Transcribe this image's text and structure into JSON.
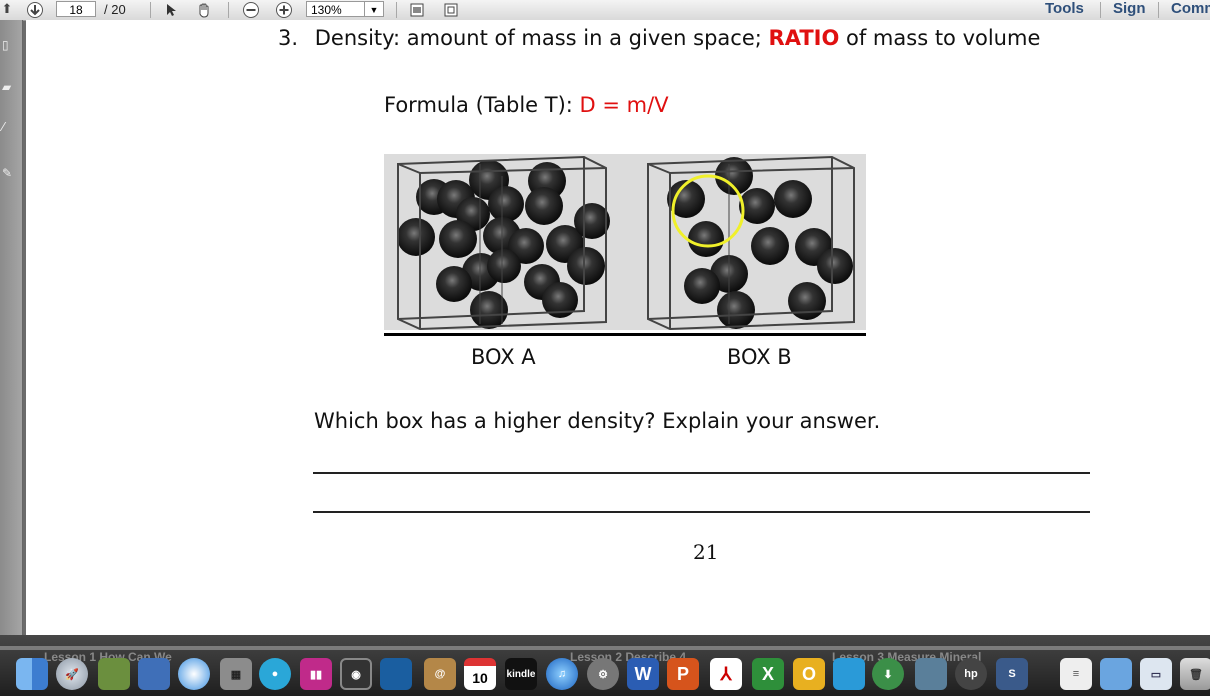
{
  "toolbar": {
    "page_current": "18",
    "page_total": "/ 20",
    "zoom": "130%",
    "tools_label": "Tools",
    "sign_label": "Sign",
    "comment_label": "Comm"
  },
  "document": {
    "heading_number": "3.",
    "heading_text": "Density:  amount of mass in a given space;",
    "heading_emphasis": "RATIO",
    "heading_suffix": "of mass to volume",
    "formula_label": "Formula (Table T):",
    "formula_value": "D = m/V",
    "box_a_label": "BOX A",
    "box_b_label": "BOX B",
    "question": "Which box has a higher density?  Explain your answer.",
    "page_number": "21"
  },
  "dock": {
    "labels": [
      "Lesson 1 How Can We",
      "Lesson 2 Describe 4",
      "Lesson 3 Measure Mineral"
    ],
    "icons": [
      "finder-icon",
      "launchpad-icon",
      "photo-icon",
      "preview-icon",
      "safari-icon",
      "calculator-icon",
      "disk-icon",
      "itunes-eq-icon",
      "camera-icon",
      "spotlight-icon",
      "contacts-icon",
      "calendar-icon",
      "kindle-icon",
      "itunes-icon",
      "system-preferences-icon",
      "word-icon",
      "powerpoint-icon",
      "acrobat-icon",
      "excel-icon",
      "outlook-icon",
      "messenger-icon",
      "download-icon",
      "network-icon",
      "hp-icon",
      "sym-icon",
      "document-icon",
      "downloads-folder-icon",
      "finder-window-icon",
      "trash-icon"
    ],
    "calendar_day": "10",
    "kindle_text": "kindle"
  },
  "colors": {
    "accent_red": "#e01010",
    "highlight_circle": "#f0f02a",
    "page_bg": "#ffffff",
    "dock_bg": "#2a2a2a"
  }
}
